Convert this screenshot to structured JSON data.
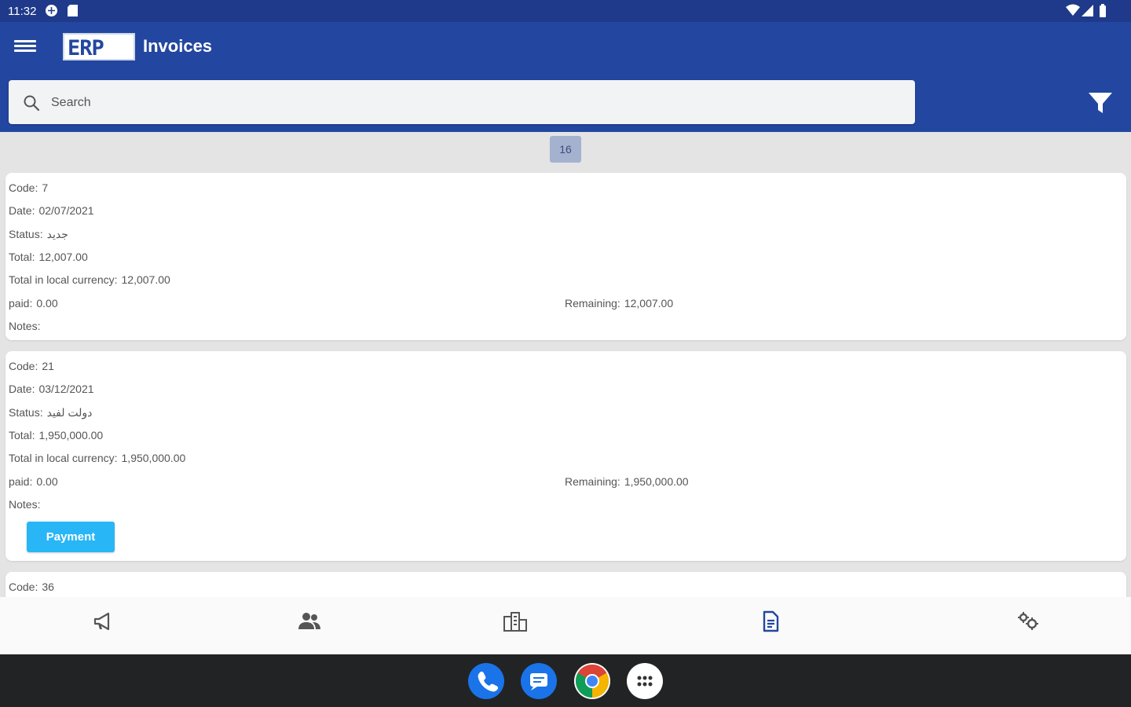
{
  "status_bar": {
    "time": "11:32"
  },
  "app": {
    "title": "Invoices",
    "logo_text": "ERP"
  },
  "search": {
    "placeholder": "Search"
  },
  "list": {
    "count": "16",
    "labels": {
      "code": "Code:",
      "date": "Date:",
      "status": "Status:",
      "total": "Total:",
      "total_local": "Total in local currency:",
      "paid": "paid:",
      "remaining": "Remaining:",
      "notes": "Notes:"
    },
    "invoices": [
      {
        "code": "7",
        "date": "02/07/2021",
        "status": "جديد",
        "total": "12,007.00",
        "total_local": "12,007.00",
        "paid": "0.00",
        "remaining": "12,007.00",
        "notes": ""
      },
      {
        "code": "21",
        "date": "03/12/2021",
        "status": "دولت لفيد",
        "total": "1,950,000.00",
        "total_local": "1,950,000.00",
        "paid": "0.00",
        "remaining": "1,950,000.00",
        "notes": "",
        "payment_label": "Payment"
      },
      {
        "code": "36"
      }
    ]
  },
  "bottom_nav": {
    "items": [
      {
        "icon": "megaphone-icon"
      },
      {
        "icon": "people-icon"
      },
      {
        "icon": "buildings-icon"
      },
      {
        "icon": "invoice-document-icon",
        "active": true
      },
      {
        "icon": "settings-gears-icon"
      }
    ],
    "active_color": "#2347a0",
    "inactive_color": "#555555"
  },
  "dock": [
    {
      "icon": "phone-app-icon"
    },
    {
      "icon": "messages-app-icon"
    },
    {
      "icon": "chrome-app-icon"
    },
    {
      "icon": "app-drawer-icon"
    }
  ],
  "colors": {
    "primary": "#2347a0",
    "status_bar": "#1f3a8a",
    "payment_button": "#29b6f6",
    "count_badge": "#a4b2d0"
  }
}
